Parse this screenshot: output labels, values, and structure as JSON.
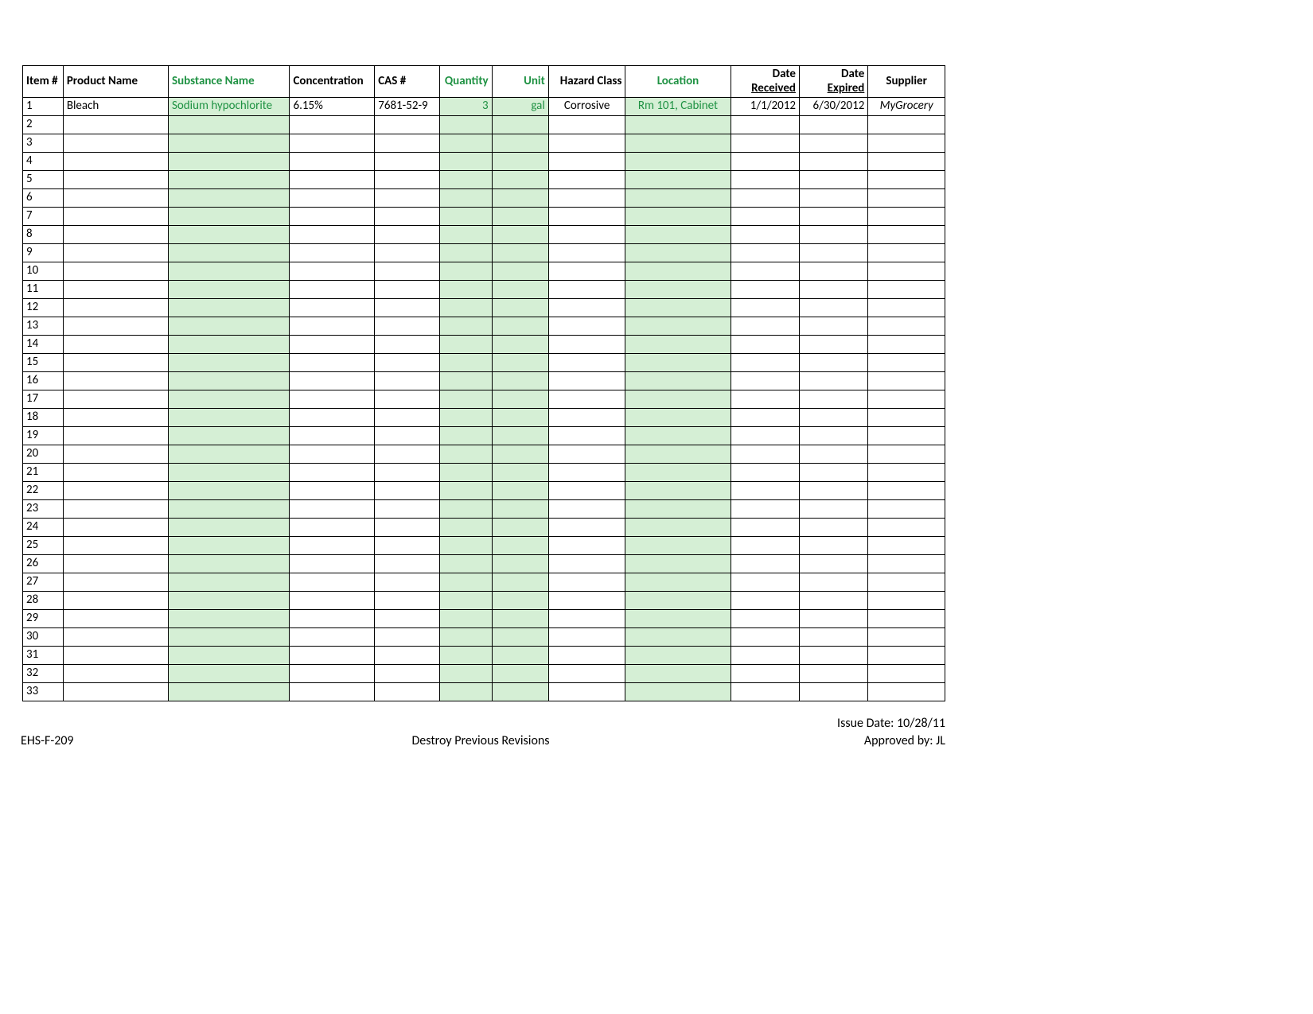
{
  "headers": {
    "item": "Item #",
    "product": "Product Name",
    "substance": "Substance Name",
    "concentration": "Concentration",
    "cas": "CAS #",
    "quantity": "Quantity",
    "unit": "Unit",
    "hazard": "Hazard Class",
    "location": "Location",
    "date_received_top": "Date",
    "date_received_bot": "Received",
    "date_expired_top": "Date",
    "date_expired_bot": "Expired",
    "supplier": "Supplier"
  },
  "rows": [
    {
      "item": "1",
      "product": "Bleach",
      "substance": "Sodium hypochlorite",
      "concentration": "6.15%",
      "cas": "7681-52-9",
      "quantity": "3",
      "unit": "gal",
      "hazard": "Corrosive",
      "location": "Rm 101, Cabinet",
      "date_received": "1/1/2012",
      "date_expired": "6/30/2012",
      "supplier": "MyGrocery"
    },
    {
      "item": "2"
    },
    {
      "item": "3"
    },
    {
      "item": "4"
    },
    {
      "item": "5"
    },
    {
      "item": "6"
    },
    {
      "item": "7"
    },
    {
      "item": "8"
    },
    {
      "item": "9"
    },
    {
      "item": "10"
    },
    {
      "item": "11"
    },
    {
      "item": "12"
    },
    {
      "item": "13"
    },
    {
      "item": "14"
    },
    {
      "item": "15"
    },
    {
      "item": "16"
    },
    {
      "item": "17"
    },
    {
      "item": "18"
    },
    {
      "item": "19"
    },
    {
      "item": "20"
    },
    {
      "item": "21"
    },
    {
      "item": "22"
    },
    {
      "item": "23"
    },
    {
      "item": "24"
    },
    {
      "item": "25"
    },
    {
      "item": "26"
    },
    {
      "item": "27"
    },
    {
      "item": "28"
    },
    {
      "item": "29"
    },
    {
      "item": "30"
    },
    {
      "item": "31"
    },
    {
      "item": "32"
    },
    {
      "item": "33"
    }
  ],
  "footer": {
    "form_id": "EHS-F-209",
    "center": "Destroy Previous Revisions",
    "issue_date": "Issue Date: 10/28/11",
    "approved": "Approved by: JL"
  }
}
